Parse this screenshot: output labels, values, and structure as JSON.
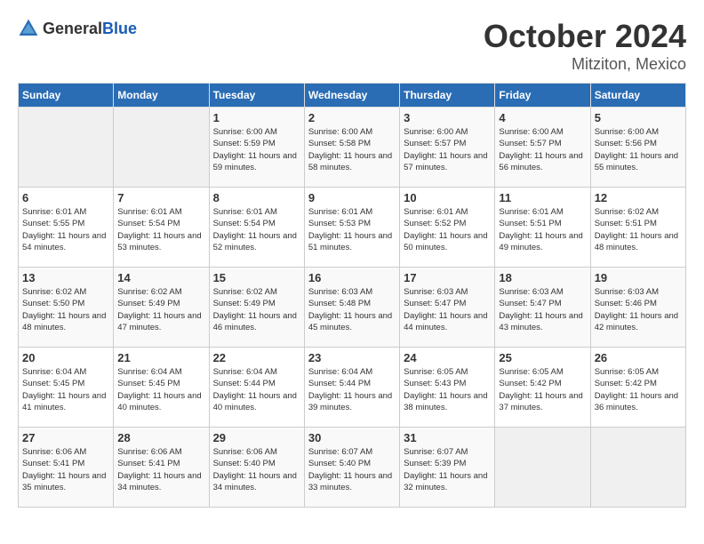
{
  "logo": {
    "general": "General",
    "blue": "Blue"
  },
  "header": {
    "month": "October 2024",
    "location": "Mitziton, Mexico"
  },
  "weekdays": [
    "Sunday",
    "Monday",
    "Tuesday",
    "Wednesday",
    "Thursday",
    "Friday",
    "Saturday"
  ],
  "weeks": [
    [
      {
        "day": "",
        "info": ""
      },
      {
        "day": "",
        "info": ""
      },
      {
        "day": "1",
        "info": "Sunrise: 6:00 AM\nSunset: 5:59 PM\nDaylight: 11 hours and 59 minutes."
      },
      {
        "day": "2",
        "info": "Sunrise: 6:00 AM\nSunset: 5:58 PM\nDaylight: 11 hours and 58 minutes."
      },
      {
        "day": "3",
        "info": "Sunrise: 6:00 AM\nSunset: 5:57 PM\nDaylight: 11 hours and 57 minutes."
      },
      {
        "day": "4",
        "info": "Sunrise: 6:00 AM\nSunset: 5:57 PM\nDaylight: 11 hours and 56 minutes."
      },
      {
        "day": "5",
        "info": "Sunrise: 6:00 AM\nSunset: 5:56 PM\nDaylight: 11 hours and 55 minutes."
      }
    ],
    [
      {
        "day": "6",
        "info": "Sunrise: 6:01 AM\nSunset: 5:55 PM\nDaylight: 11 hours and 54 minutes."
      },
      {
        "day": "7",
        "info": "Sunrise: 6:01 AM\nSunset: 5:54 PM\nDaylight: 11 hours and 53 minutes."
      },
      {
        "day": "8",
        "info": "Sunrise: 6:01 AM\nSunset: 5:54 PM\nDaylight: 11 hours and 52 minutes."
      },
      {
        "day": "9",
        "info": "Sunrise: 6:01 AM\nSunset: 5:53 PM\nDaylight: 11 hours and 51 minutes."
      },
      {
        "day": "10",
        "info": "Sunrise: 6:01 AM\nSunset: 5:52 PM\nDaylight: 11 hours and 50 minutes."
      },
      {
        "day": "11",
        "info": "Sunrise: 6:01 AM\nSunset: 5:51 PM\nDaylight: 11 hours and 49 minutes."
      },
      {
        "day": "12",
        "info": "Sunrise: 6:02 AM\nSunset: 5:51 PM\nDaylight: 11 hours and 48 minutes."
      }
    ],
    [
      {
        "day": "13",
        "info": "Sunrise: 6:02 AM\nSunset: 5:50 PM\nDaylight: 11 hours and 48 minutes."
      },
      {
        "day": "14",
        "info": "Sunrise: 6:02 AM\nSunset: 5:49 PM\nDaylight: 11 hours and 47 minutes."
      },
      {
        "day": "15",
        "info": "Sunrise: 6:02 AM\nSunset: 5:49 PM\nDaylight: 11 hours and 46 minutes."
      },
      {
        "day": "16",
        "info": "Sunrise: 6:03 AM\nSunset: 5:48 PM\nDaylight: 11 hours and 45 minutes."
      },
      {
        "day": "17",
        "info": "Sunrise: 6:03 AM\nSunset: 5:47 PM\nDaylight: 11 hours and 44 minutes."
      },
      {
        "day": "18",
        "info": "Sunrise: 6:03 AM\nSunset: 5:47 PM\nDaylight: 11 hours and 43 minutes."
      },
      {
        "day": "19",
        "info": "Sunrise: 6:03 AM\nSunset: 5:46 PM\nDaylight: 11 hours and 42 minutes."
      }
    ],
    [
      {
        "day": "20",
        "info": "Sunrise: 6:04 AM\nSunset: 5:45 PM\nDaylight: 11 hours and 41 minutes."
      },
      {
        "day": "21",
        "info": "Sunrise: 6:04 AM\nSunset: 5:45 PM\nDaylight: 11 hours and 40 minutes."
      },
      {
        "day": "22",
        "info": "Sunrise: 6:04 AM\nSunset: 5:44 PM\nDaylight: 11 hours and 40 minutes."
      },
      {
        "day": "23",
        "info": "Sunrise: 6:04 AM\nSunset: 5:44 PM\nDaylight: 11 hours and 39 minutes."
      },
      {
        "day": "24",
        "info": "Sunrise: 6:05 AM\nSunset: 5:43 PM\nDaylight: 11 hours and 38 minutes."
      },
      {
        "day": "25",
        "info": "Sunrise: 6:05 AM\nSunset: 5:42 PM\nDaylight: 11 hours and 37 minutes."
      },
      {
        "day": "26",
        "info": "Sunrise: 6:05 AM\nSunset: 5:42 PM\nDaylight: 11 hours and 36 minutes."
      }
    ],
    [
      {
        "day": "27",
        "info": "Sunrise: 6:06 AM\nSunset: 5:41 PM\nDaylight: 11 hours and 35 minutes."
      },
      {
        "day": "28",
        "info": "Sunrise: 6:06 AM\nSunset: 5:41 PM\nDaylight: 11 hours and 34 minutes."
      },
      {
        "day": "29",
        "info": "Sunrise: 6:06 AM\nSunset: 5:40 PM\nDaylight: 11 hours and 34 minutes."
      },
      {
        "day": "30",
        "info": "Sunrise: 6:07 AM\nSunset: 5:40 PM\nDaylight: 11 hours and 33 minutes."
      },
      {
        "day": "31",
        "info": "Sunrise: 6:07 AM\nSunset: 5:39 PM\nDaylight: 11 hours and 32 minutes."
      },
      {
        "day": "",
        "info": ""
      },
      {
        "day": "",
        "info": ""
      }
    ]
  ]
}
